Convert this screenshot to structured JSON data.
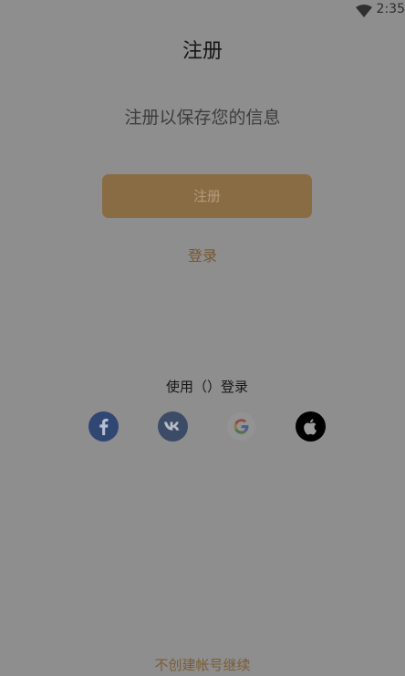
{
  "status_bar": {
    "time": "2:35",
    "wifi_icon": "wifi-icon"
  },
  "header": {
    "title": "注册"
  },
  "main": {
    "subtitle": "注册以保存您的信息",
    "register_label": "注册",
    "login_label": "登录"
  },
  "social": {
    "label": "使用（）登录",
    "icons": [
      "facebook-icon",
      "vk-icon",
      "google-icon",
      "apple-icon"
    ]
  },
  "footer": {
    "continue_label": "不创建帐号继续"
  },
  "colors": {
    "accent": "#8a6c44",
    "link": "#76592f",
    "background": "#8e8e8e"
  }
}
